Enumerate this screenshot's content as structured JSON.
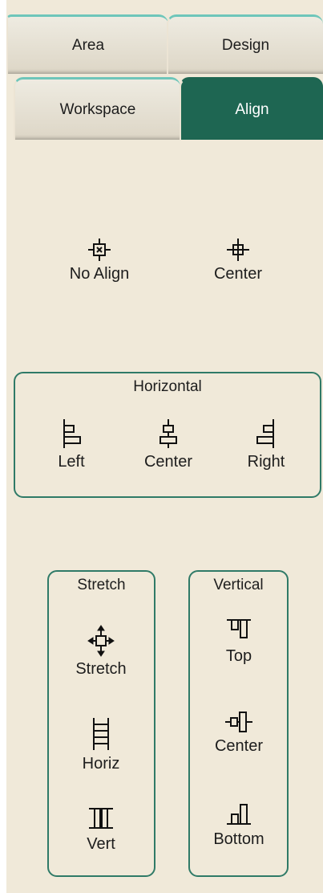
{
  "tabs": [
    {
      "label": "Area"
    },
    {
      "label": "Design"
    },
    {
      "label": "Workspace"
    },
    {
      "label": "Align"
    }
  ],
  "top_buttons": [
    {
      "label": "No Align",
      "icon": "no-align-icon"
    },
    {
      "label": "Center",
      "icon": "center-crosshair-icon"
    }
  ],
  "horizontal": {
    "title": "Horizontal",
    "buttons": [
      {
        "label": "Left",
        "icon": "align-left-icon"
      },
      {
        "label": "Center",
        "icon": "align-center-horizontal-icon"
      },
      {
        "label": "Right",
        "icon": "align-right-icon"
      }
    ]
  },
  "stretch": {
    "title": "Stretch",
    "buttons": [
      {
        "label": "Stretch",
        "icon": "stretch-all-icon"
      },
      {
        "label": "Horiz",
        "icon": "stretch-horizontal-icon"
      },
      {
        "label": "Vert",
        "icon": "stretch-vertical-icon"
      }
    ]
  },
  "vertical": {
    "title": "Vertical",
    "buttons": [
      {
        "label": "Top",
        "icon": "align-top-icon"
      },
      {
        "label": "Center",
        "icon": "align-center-vertical-icon"
      },
      {
        "label": "Bottom",
        "icon": "align-bottom-icon"
      }
    ]
  },
  "colors": {
    "panel_bg": "#f0e9d9",
    "active_tab": "#1e6652",
    "group_border": "#2f7a67"
  }
}
